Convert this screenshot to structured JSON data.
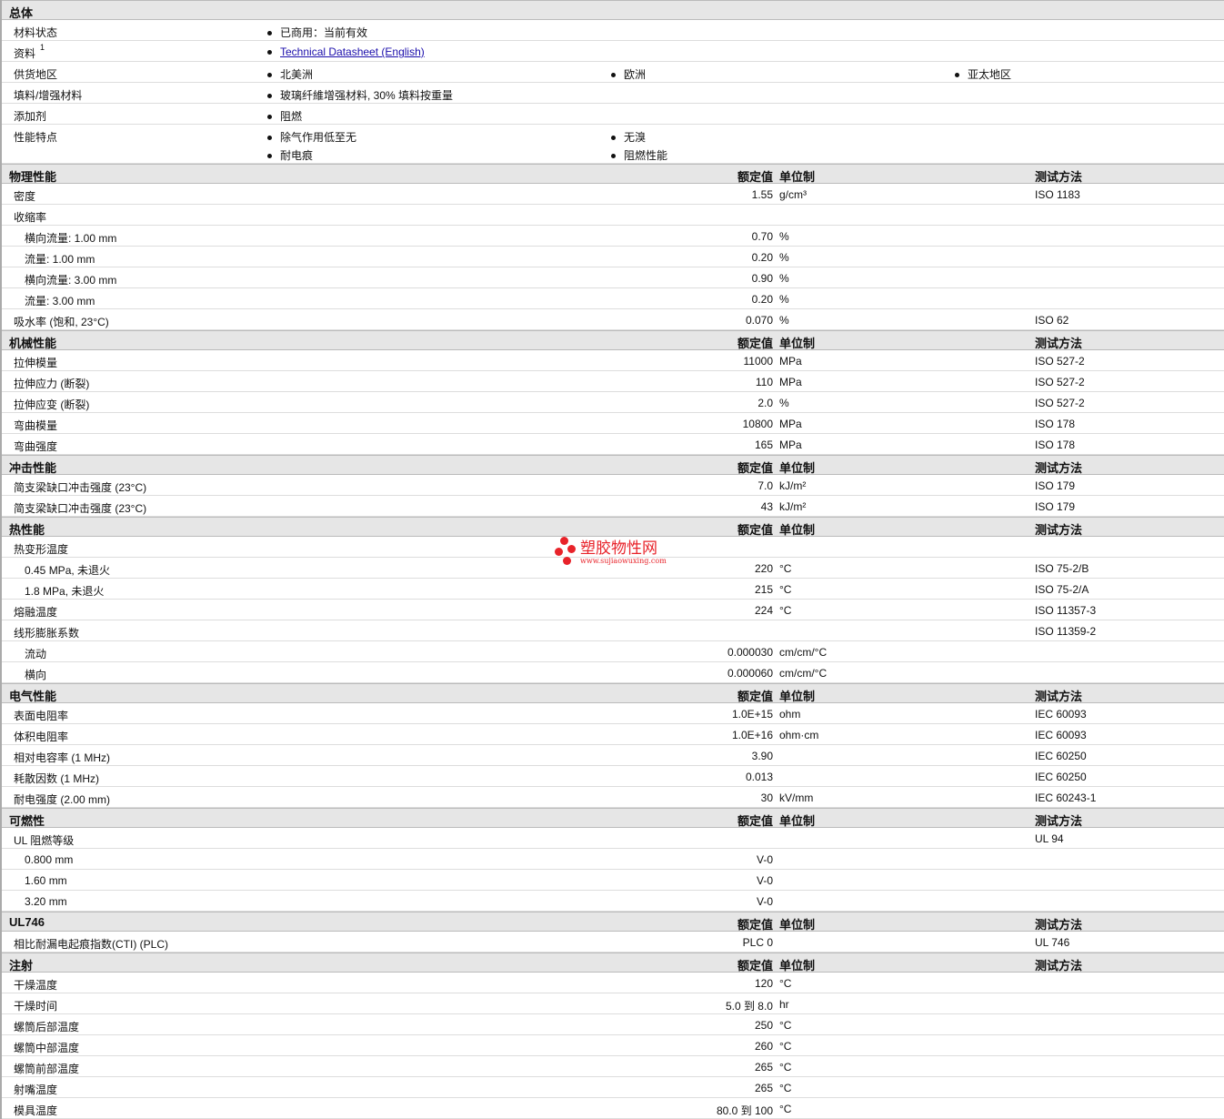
{
  "general": {
    "title": "总体",
    "rows": [
      {
        "label": "材料状态",
        "items": [
          "已商用：当前有效"
        ]
      },
      {
        "label": "资料",
        "sup": "1",
        "items": [
          "Technical Datasheet (English)"
        ],
        "link": true
      },
      {
        "label": "供货地区",
        "items": [
          "北美洲",
          "欧洲",
          "亚太地区"
        ]
      },
      {
        "label": "填料/增强材料",
        "items": [
          "玻璃纤維增强材料, 30% 填料按重量"
        ]
      },
      {
        "label": "添加剂",
        "items": [
          "阻燃"
        ]
      },
      {
        "label": "性能特点",
        "items": [
          "除气作用低至无",
          "无溴",
          "耐电痕",
          "阻燃性能"
        ]
      }
    ]
  },
  "headers": {
    "value": "额定值",
    "unit": "单位制",
    "method": "测试方法"
  },
  "sections": [
    {
      "title": "物理性能",
      "rows": [
        {
          "label": "密度",
          "value": "1.55",
          "unit": "g/cm³",
          "method": "ISO 1183"
        },
        {
          "label": "收缩率"
        },
        {
          "label": "横向流量: 1.00 mm",
          "indent": true,
          "value": "0.70",
          "unit": "%"
        },
        {
          "label": "流量: 1.00 mm",
          "indent": true,
          "value": "0.20",
          "unit": "%"
        },
        {
          "label": "横向流量: 3.00 mm",
          "indent": true,
          "value": "0.90",
          "unit": "%"
        },
        {
          "label": "流量: 3.00 mm",
          "indent": true,
          "value": "0.20",
          "unit": "%"
        },
        {
          "label": "吸水率 (饱和, 23°C)",
          "value": "0.070",
          "unit": "%",
          "method": "ISO 62"
        }
      ]
    },
    {
      "title": "机械性能",
      "rows": [
        {
          "label": "拉伸模量",
          "value": "11000",
          "unit": "MPa",
          "method": "ISO 527-2"
        },
        {
          "label": "拉伸应力 (断裂)",
          "value": "110",
          "unit": "MPa",
          "method": "ISO 527-2"
        },
        {
          "label": "拉伸应变 (断裂)",
          "value": "2.0",
          "unit": "%",
          "method": "ISO 527-2"
        },
        {
          "label": "弯曲模量",
          "value": "10800",
          "unit": "MPa",
          "method": "ISO 178"
        },
        {
          "label": "弯曲强度",
          "value": "165",
          "unit": "MPa",
          "method": "ISO 178"
        }
      ]
    },
    {
      "title": "冲击性能",
      "rows": [
        {
          "label": "简支梁缺口冲击强度 (23°C)",
          "value": "7.0",
          "unit": "kJ/m²",
          "method": "ISO 179"
        },
        {
          "label": "简支梁缺口冲击强度 (23°C)",
          "value": "43",
          "unit": "kJ/m²",
          "method": "ISO 179"
        }
      ]
    },
    {
      "title": "热性能",
      "rows": [
        {
          "label": "热变形温度"
        },
        {
          "label": "0.45 MPa, 未退火",
          "indent": true,
          "value": "220",
          "unit": "°C",
          "method": "ISO 75-2/B"
        },
        {
          "label": "1.8 MPa, 未退火",
          "indent": true,
          "value": "215",
          "unit": "°C",
          "method": "ISO 75-2/A"
        },
        {
          "label": "熔融温度",
          "value": "224",
          "unit": "°C",
          "method": "ISO 11357-3"
        },
        {
          "label": "线形膨胀系数",
          "method": "ISO 11359-2"
        },
        {
          "label": "流动",
          "indent": true,
          "value": "0.000030",
          "unit": "cm/cm/°C"
        },
        {
          "label": "横向",
          "indent": true,
          "value": "0.000060",
          "unit": "cm/cm/°C"
        }
      ]
    },
    {
      "title": "电气性能",
      "rows": [
        {
          "label": "表面电阻率",
          "value": "1.0E+15",
          "unit": "ohm",
          "method": "IEC 60093"
        },
        {
          "label": "体积电阻率",
          "value": "1.0E+16",
          "unit": "ohm·cm",
          "method": "IEC 60093"
        },
        {
          "label": "相对电容率 (1 MHz)",
          "value": "3.90",
          "method": "IEC 60250"
        },
        {
          "label": "耗散因数 (1 MHz)",
          "value": "0.013",
          "method": "IEC 60250"
        },
        {
          "label": "耐电强度 (2.00 mm)",
          "value": "30",
          "unit": "kV/mm",
          "method": "IEC 60243-1"
        }
      ]
    },
    {
      "title": "可燃性",
      "rows": [
        {
          "label": "UL 阻燃等级",
          "method": "UL 94"
        },
        {
          "label": "0.800 mm",
          "indent": true,
          "value": "V-0"
        },
        {
          "label": "1.60 mm",
          "indent": true,
          "value": "V-0"
        },
        {
          "label": "3.20 mm",
          "indent": true,
          "value": "V-0"
        }
      ]
    },
    {
      "title": "UL746",
      "rows": [
        {
          "label": "相比耐漏电起痕指数(CTI) (PLC)",
          "value": "PLC 0",
          "method": "UL 746"
        }
      ]
    },
    {
      "title": "注射",
      "rows": [
        {
          "label": "干燥温度",
          "value": "120",
          "unit": "°C"
        },
        {
          "label": "干燥时间",
          "value": "5.0 到  8.0",
          "unit": "hr"
        },
        {
          "label": "螺筒后部温度",
          "value": "250",
          "unit": "°C"
        },
        {
          "label": "螺筒中部温度",
          "value": "260",
          "unit": "°C"
        },
        {
          "label": "螺筒前部温度",
          "value": "265",
          "unit": "°C"
        },
        {
          "label": "射嘴温度",
          "value": "265",
          "unit": "°C"
        },
        {
          "label": "模具温度",
          "value": "80.0 到  100",
          "unit": "°C"
        }
      ]
    }
  ],
  "watermark": {
    "title": "塑胶物性网",
    "url": "www.sujiaowuxing.com"
  }
}
